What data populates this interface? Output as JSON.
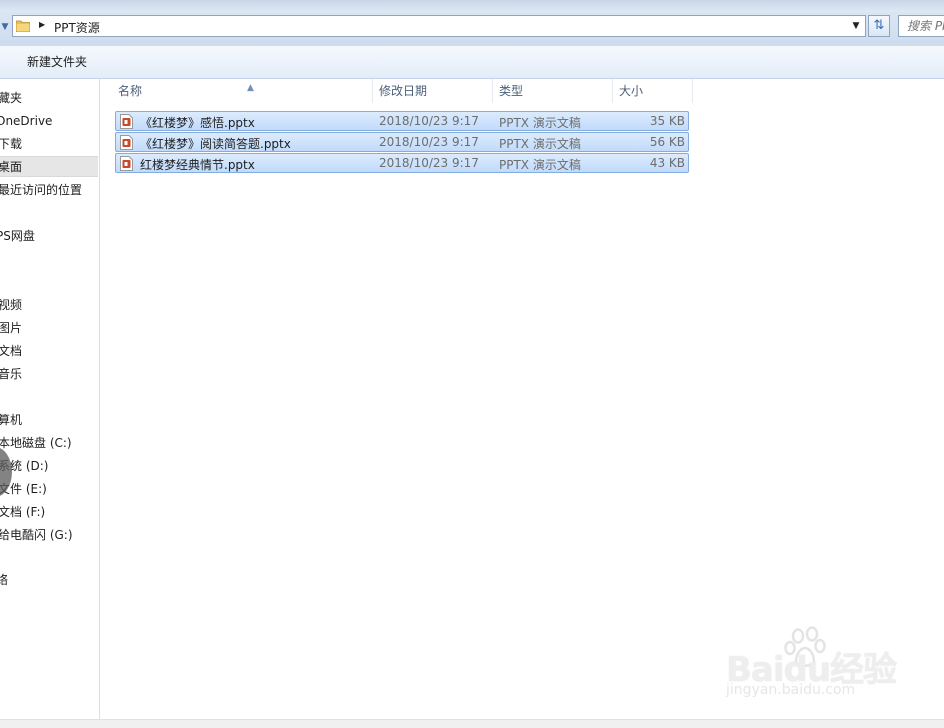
{
  "address_bar": {
    "path": "PPT资源",
    "search_placeholder": "搜索 PPT资源"
  },
  "toolbar": {
    "new_folder_label": "新建文件夹"
  },
  "nav_pane": {
    "items": [
      {
        "label": "藏夹"
      },
      {
        "label": "OneDrive"
      },
      {
        "label": "下载"
      },
      {
        "label": "桌面",
        "selected": true
      },
      {
        "label": "最近访问的位置"
      },
      {
        "label": "PS网盘"
      },
      {
        "label": "视频"
      },
      {
        "label": "图片"
      },
      {
        "label": "文档"
      },
      {
        "label": "音乐"
      },
      {
        "label": "算机"
      },
      {
        "label": "本地磁盘 (C:)"
      },
      {
        "label": "系统 (D:)"
      },
      {
        "label": "文件 (E:)"
      },
      {
        "label": "文档 (F:)"
      },
      {
        "label": "给电酷闪 (G:)"
      },
      {
        "label": "络"
      }
    ]
  },
  "file_list": {
    "columns": {
      "name": "名称",
      "modified": "修改日期",
      "type": "类型",
      "size": "大小"
    },
    "files": [
      {
        "name": "《红楼梦》感悟.pptx",
        "modified": "2018/10/23 9:17",
        "type": "PPTX 演示文稿",
        "size": "35 KB",
        "selected": true
      },
      {
        "name": "《红楼梦》阅读简答题.pptx",
        "modified": "2018/10/23 9:17",
        "type": "PPTX 演示文稿",
        "size": "56 KB",
        "selected": true
      },
      {
        "name": "红楼梦经典情节.pptx",
        "modified": "2018/10/23 9:17",
        "type": "PPTX 演示文稿",
        "size": "43 KB",
        "selected": true
      }
    ]
  },
  "watermark": {
    "logo": "Baidu经验",
    "url": "jingyan.baidu.com"
  },
  "colors": {
    "selection_fill": "#c8defc",
    "selection_border": "#84acdd",
    "header_text": "#4c607a",
    "pptx_icon": "#c74a2b"
  }
}
